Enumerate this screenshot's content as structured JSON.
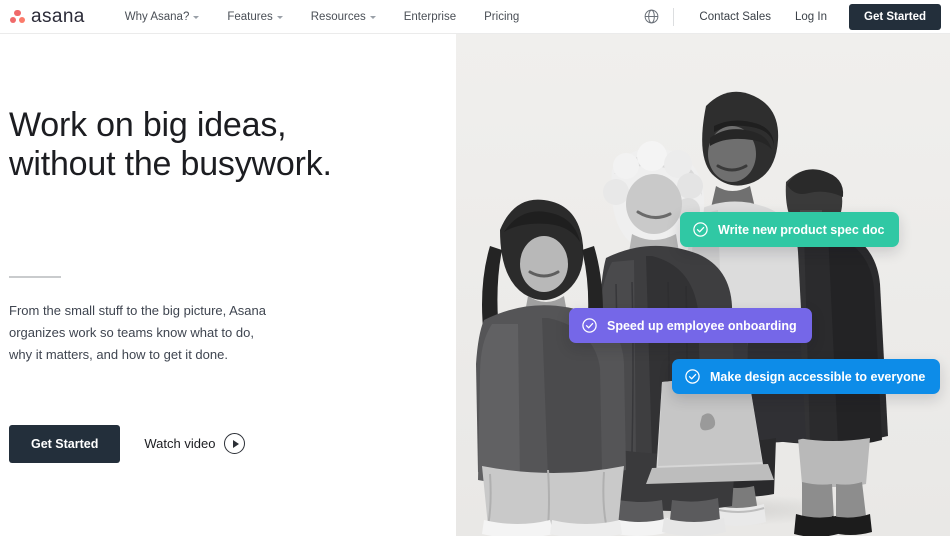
{
  "brand": {
    "name": "asana",
    "logo_icon": "asana-dots-logo",
    "dot_colors": [
      "#f06a6a",
      "#f06a6a",
      "#fb7b6b"
    ]
  },
  "nav": {
    "links": [
      {
        "label": "Why Asana?",
        "has_caret": true
      },
      {
        "label": "Features",
        "has_caret": true
      },
      {
        "label": "Resources",
        "has_caret": true
      },
      {
        "label": "Enterprise",
        "has_caret": false
      },
      {
        "label": "Pricing",
        "has_caret": false
      }
    ],
    "globe_icon": "globe-icon",
    "contact_sales": "Contact Sales",
    "log_in": "Log In",
    "get_started": "Get Started"
  },
  "hero": {
    "headline_line1": "Work on big ideas,",
    "headline_line2": "without the busywork.",
    "subcopy_line1": "From the small stuff to the big picture, Asana",
    "subcopy_line2": "organizes work so teams know what to do,",
    "subcopy_line3": "why it matters, and how to get it done.",
    "cta_primary": "Get Started",
    "cta_video": "Watch video",
    "play_icon": "play-circle-icon"
  },
  "pills": [
    {
      "label": "Write new product spec doc",
      "color": "#30c8a4",
      "icon": "check-circle-icon"
    },
    {
      "label": "Speed up employee onboarding",
      "color": "#7567e8",
      "icon": "check-circle-icon"
    },
    {
      "label": "Make design accessible to everyone",
      "color": "#0d8ce8",
      "icon": "check-circle-icon"
    }
  ],
  "colors": {
    "dark_button": "#232f3b",
    "photo_background": "#f0efed",
    "nav_text": "#4a4f56"
  }
}
